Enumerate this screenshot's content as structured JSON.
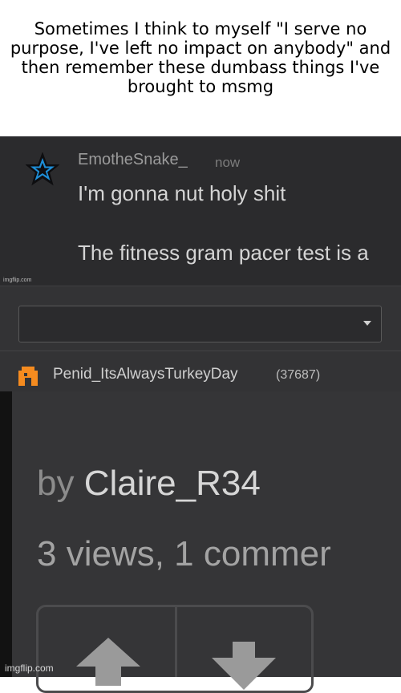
{
  "caption": "Sometimes I think to myself \"I serve no purpose, I've left no impact on anybody\" and then remember these dumbass things I've brought to msmg",
  "comment_top": {
    "username": "EmotheSnake_",
    "timestamp": "now",
    "line1": "I'm gonna nut holy shit",
    "line2": "The fitness gram pacer test is a",
    "avatar_icon": "star-icon",
    "watermark": "imgflip.com"
  },
  "comment_bottom": {
    "username": "Penid_ItsAlwaysTurkeyDay",
    "points": "(37687)",
    "avatar_icon": "pixel-avatar-icon",
    "accent_color": "#f58b1f"
  },
  "post": {
    "by_word": "by",
    "author": "Claire_R34",
    "stats": "3 views, 1 commer",
    "upvote_icon": "arrow-up-icon",
    "downvote_icon": "arrow-down-icon"
  },
  "watermark": "imgflip.com"
}
